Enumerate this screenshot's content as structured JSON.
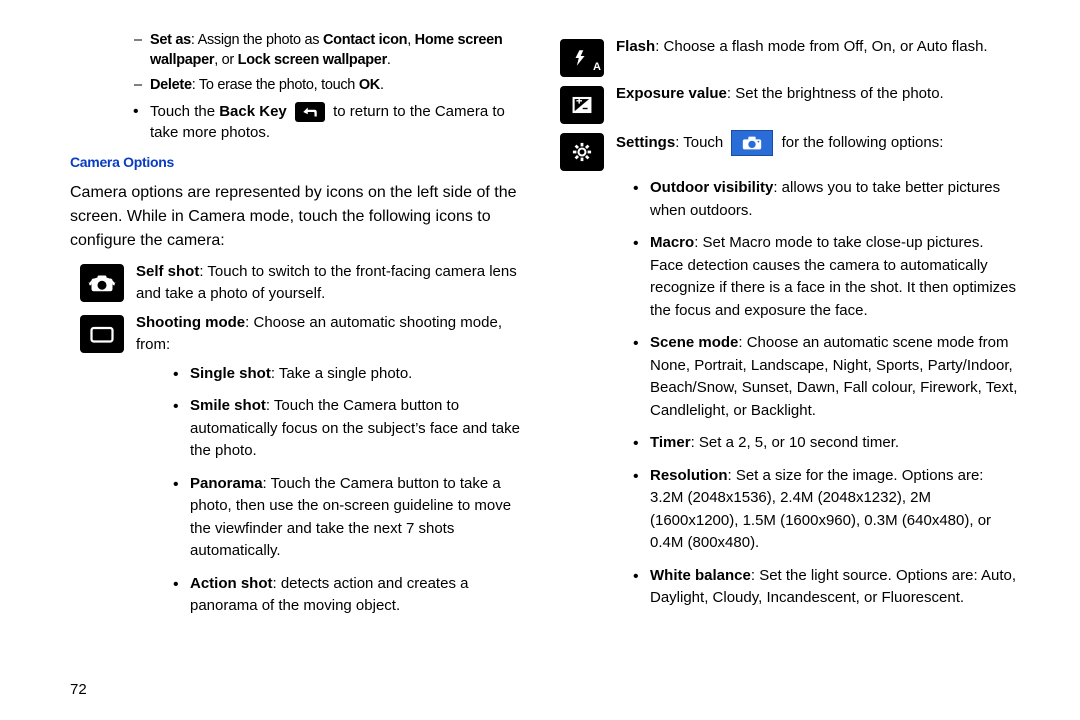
{
  "left": {
    "dash": {
      "set_as": {
        "label": "Set as",
        "rest": ": Assign the photo as ",
        "b1": "Contact icon",
        "sep1": ", ",
        "b2": "Home screen wallpaper",
        "sep2": ", or ",
        "b3": "Lock screen wallpaper",
        "end": "."
      },
      "delete": {
        "label": "Delete",
        "rest": ": To erase the photo, touch ",
        "ok": "OK",
        "end": "."
      }
    },
    "back_bullet": {
      "pre": "Touch the ",
      "key": "Back Key ",
      "post": " to return to the Camera to take more photos."
    },
    "section": "Camera Options",
    "intro": "Camera options are represented by icons on the left side of the screen. While in Camera mode, touch the following icons to configure the camera:",
    "selfshot": {
      "label": "Self shot",
      "rest": ": Touch to switch to the front-facing camera lens and take a photo of yourself."
    },
    "shooting": {
      "label": "Shooting mode",
      "rest": ": Choose an automatic shooting mode, from:"
    },
    "modes": {
      "single": {
        "label": "Single shot",
        "rest": ": Take a single photo."
      },
      "smile": {
        "label": "Smile shot",
        "rest": ": Touch the Camera button to automatically focus on the subject’s face and take the photo."
      },
      "panorama": {
        "label": "Panorama",
        "rest": ": Touch the Camera button to take a photo, then use the on-screen guideline to move the viewfinder and take the next 7 shots automatically."
      },
      "action": {
        "label": "Action shot",
        "rest": ": detects action and creates a panorama of the moving object."
      }
    },
    "pagenum": "72"
  },
  "right": {
    "flash": {
      "label": "Flash",
      "rest": ": Choose a flash mode from Off, On, or Auto flash."
    },
    "exposure": {
      "label": "Exposure value",
      "rest": ": Set the brightness of the photo."
    },
    "settings": {
      "label": "Settings",
      "pre": ": Touch ",
      "post": " for the following options:"
    },
    "opts": {
      "outdoor": {
        "label": "Outdoor visibility",
        "rest": ": allows you to take better pictures when outdoors."
      },
      "macro": {
        "label": "Macro",
        "rest": ": Set Macro mode to take close-up pictures. Face detection causes the camera to automatically recognize if there is a face in the shot. It then optimizes the focus and exposure the face."
      },
      "scene": {
        "label": "Scene mode",
        "rest": ": Choose an automatic scene mode from None, Portrait, Landscape, Night, Sports, Party/Indoor, Beach/Snow, Sunset, Dawn, Fall colour, Firework, Text, Candlelight, or Backlight."
      },
      "timer": {
        "label": "Timer",
        "rest": ": Set a 2, 5, or 10 second timer."
      },
      "resolution": {
        "label": "Resolution",
        "rest": ": Set a size for the image. Options are: 3.2M (2048x1536), 2.4M (2048x1232), 2M (1600x1200), 1.5M (1600x960), 0.3M (640x480), or 0.4M (800x480)."
      },
      "wb": {
        "label": "White balance",
        "rest": ": Set the light source. Options are: Auto, Daylight, Cloudy, Incandescent, or Fluorescent."
      }
    }
  }
}
